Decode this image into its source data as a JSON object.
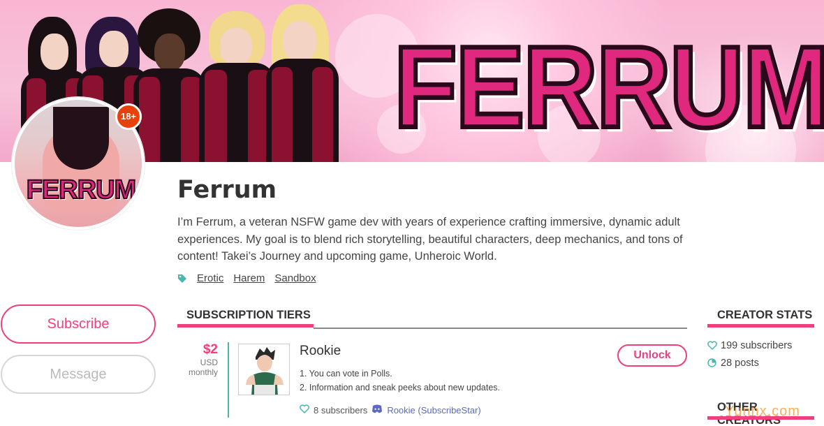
{
  "banner": {
    "logo_text": "FERRUM"
  },
  "avatar": {
    "logo_text": "FERRUM",
    "age_badge": "18+"
  },
  "creator": {
    "name": "Ferrum",
    "bio": "I’m Ferrum, a veteran NSFW game dev with years of experience crafting immersive, dynamic adult experiences. My goal is to blend rich storytelling, beautiful characters, deep mechanics, and tons of content! Takei’s Journey and upcoming game, Unheroic World.",
    "tags": [
      "Erotic",
      "Harem",
      "Sandbox"
    ]
  },
  "actions": {
    "subscribe_label": "Subscribe",
    "message_label": "Message"
  },
  "tiers_section": {
    "title": "SUBSCRIPTION TIERS",
    "tiers": [
      {
        "price": "$2",
        "currency": "USD",
        "period": "monthly",
        "name": "Rookie",
        "perks": [
          "1. You can vote in Polls.",
          "2. Information and sneak peeks about new updates."
        ],
        "subscribers": "8 subscribers",
        "discord_role": "Rookie (SubscribeStar)",
        "unlock_label": "Unlock"
      }
    ]
  },
  "stats_section": {
    "title": "CREATOR STATS",
    "subscribers": "199 subscribers",
    "posts": "28 posts"
  },
  "other_creators": {
    "title": "OTHER CREATORS"
  },
  "watermark": "Yunnx.com",
  "colors": {
    "accent": "#ef3f7d",
    "teal": "#4db6ac",
    "badge": "#e8410c",
    "discord": "#5c6bc0"
  }
}
